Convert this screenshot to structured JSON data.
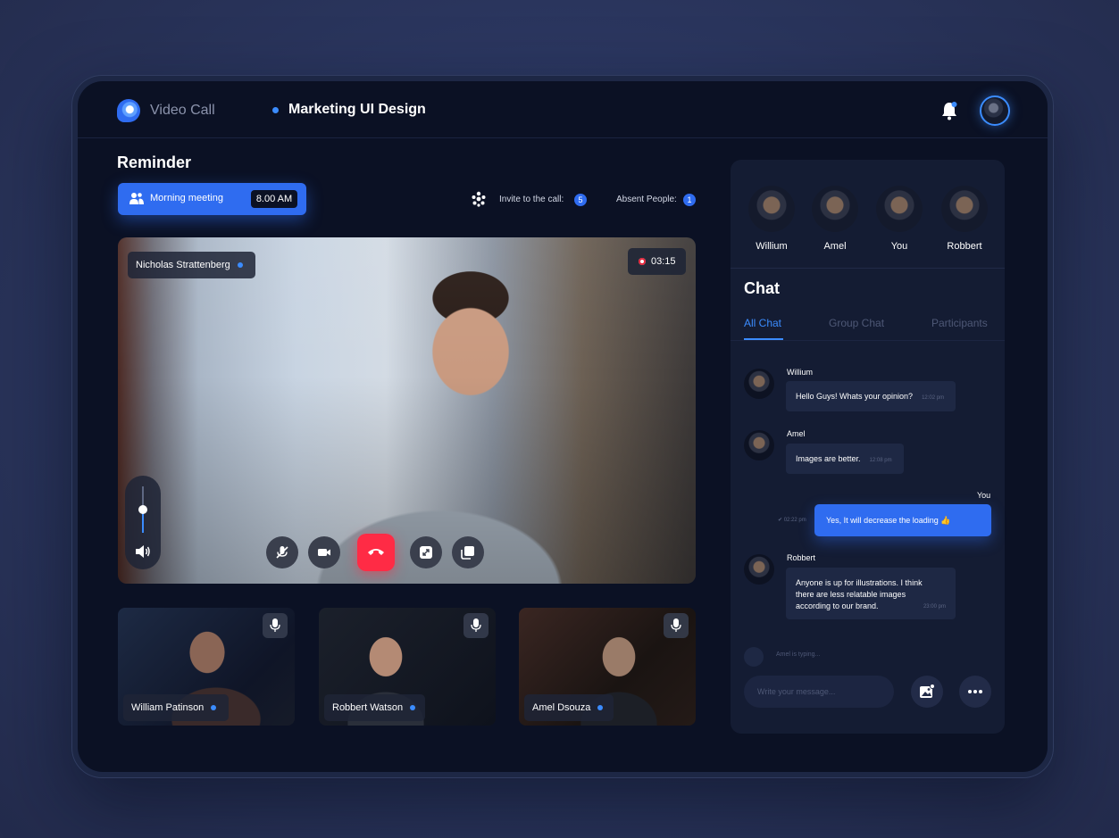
{
  "header": {
    "app_name": "Video Call",
    "project_name": "Marketing UI Design"
  },
  "reminder": {
    "title": "Reminder",
    "meeting_label": "Morning meeting",
    "meeting_time": "8.00 AM"
  },
  "call_info": {
    "invite_label": "Invite to the call:",
    "invite_count": "5",
    "absent_label": "Absent People:",
    "absent_count": "1"
  },
  "main_video": {
    "speaker_name": "Nicholas Strattenberg",
    "recording_time": "03:15",
    "volume_level": 0.5
  },
  "thumbnails": [
    {
      "name": "William Patinson"
    },
    {
      "name": "Robbert Watson"
    },
    {
      "name": "Amel Dsouza"
    }
  ],
  "participants": [
    {
      "name": "Willium"
    },
    {
      "name": "Amel"
    },
    {
      "name": "You"
    },
    {
      "name": "Robbert"
    }
  ],
  "chat": {
    "title": "Chat",
    "tabs": [
      "All Chat",
      "Group Chat",
      "Participants"
    ],
    "active_tab": "All Chat",
    "messages": [
      {
        "sender": "Willium",
        "text": "Hello Guys! Whats your opinion?",
        "time": "12:02 pm"
      },
      {
        "sender": "Amel",
        "text": "Images are better.",
        "time": "12:08 pm"
      },
      {
        "sender": "You",
        "text": "Yes, It will decrease the loading",
        "time": "02:22 pm",
        "emoji": "👍"
      },
      {
        "sender": "Robbert",
        "text_lines": [
          "Anyone is up for illustrations. I think",
          "there are less relatable images",
          "according to our brand."
        ],
        "time": "23:00 pm"
      }
    ],
    "typing_status": "Amel is typing...",
    "input_placeholder": "Write your message..."
  },
  "colors": {
    "accent": "#2f6cf0",
    "end_call": "#ff2b45",
    "background": "#0b1124",
    "panel": "#141c33"
  }
}
